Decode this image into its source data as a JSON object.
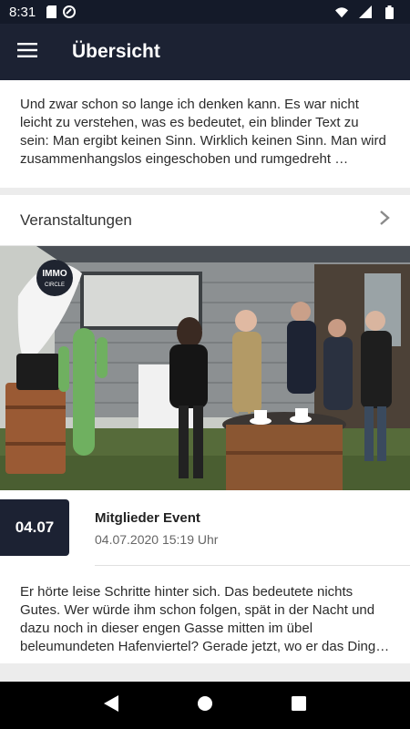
{
  "status_bar": {
    "time": "8:31",
    "icons_left": [
      "sim-card-icon",
      "circle-badge-icon"
    ],
    "icons_right": [
      "wifi-icon",
      "signal-icon",
      "battery-icon"
    ]
  },
  "app_bar": {
    "title": "Übersicht",
    "menu_icon": "hamburger-menu-icon",
    "background": "#1c2233"
  },
  "intro": {
    "text": "Und zwar schon so lange ich denken kann. Es war nicht leicht zu verstehen, was es bedeutet, ein blinder Text zu sein: Man ergibt keinen Sinn. Wirklich keinen Sinn. Man wird zusammenhangslos eingeschoben und rumgedreht …"
  },
  "events_section": {
    "title": "Veranstaltungen",
    "chevron_icon": "chevron-right-icon",
    "items": [
      {
        "image_logo_line1": "IMMO",
        "image_logo_line2": "CIRCLE",
        "date_badge": "04.07",
        "title": "Mitglieder Event",
        "datetime": "04.07.2020 15:19 Uhr",
        "description": "Er hörte leise Schritte hinter sich. Das bedeutete nichts Gutes. Wer würde ihm schon folgen, spät in der Nacht und dazu noch in dieser engen Gasse mitten im übel beleumundeten Hafenviertel? Gerade jetzt, wo er das Ding…"
      }
    ]
  },
  "nav_bar": {
    "back_icon": "back-triangle-icon",
    "home_icon": "home-circle-icon",
    "recents_icon": "recents-square-icon"
  }
}
